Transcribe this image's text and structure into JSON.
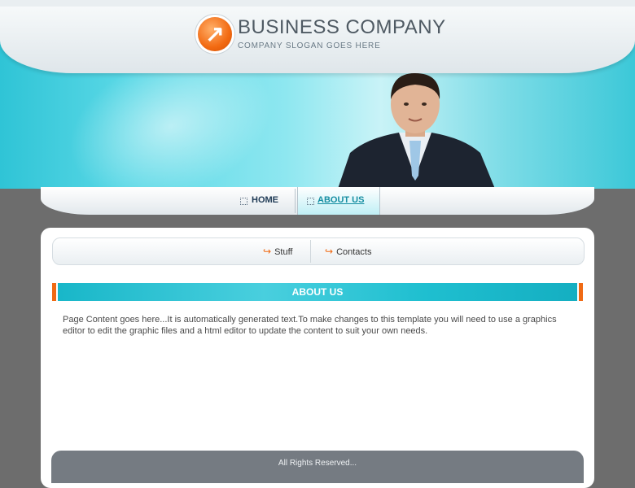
{
  "header": {
    "company_name": "BUSINESS COMPANY",
    "slogan": "COMPANY SLOGAN GOES HERE",
    "logo_icon": "arrow-up-right-icon",
    "accent_color": "#f26a12",
    "band_color": "#2fc4d6"
  },
  "nav": {
    "items": [
      {
        "label": "HOME",
        "active": false
      },
      {
        "label": "ABOUT US",
        "active": true
      }
    ]
  },
  "subnav": {
    "items": [
      {
        "label": "Stuff",
        "icon": "arrow-icon"
      },
      {
        "label": "Contacts",
        "icon": "arrow-icon"
      }
    ]
  },
  "section": {
    "title": "ABOUT US",
    "body": "Page Content goes here...It is automatically generated text.To make changes to this template you will need to use a graphics editor to edit the graphic files and a html editor to update the content to suit your own needs."
  },
  "footer": {
    "text": "All Rights Reserved..."
  }
}
